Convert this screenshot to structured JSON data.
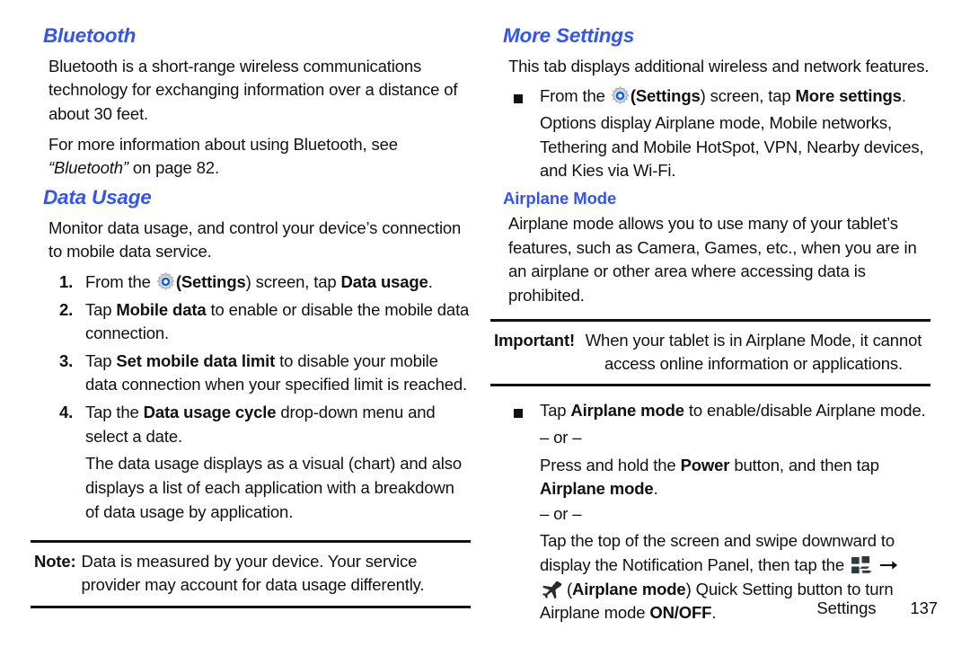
{
  "document": {
    "left_column": {
      "bluetooth": {
        "heading": "Bluetooth",
        "para1": "Bluetooth is a short-range wireless communications technology for exchanging information over a distance of about 30 feet.",
        "para2_pre": "For more information about using Bluetooth, see ",
        "para2_italic": "“Bluetooth”",
        "para2_post": " on page 82."
      },
      "data_usage": {
        "heading": "Data Usage",
        "intro": "Monitor data usage, and control your device’s connection to mobile data service.",
        "steps": [
          {
            "num": "1.",
            "pre": "From the ",
            "icon": "settings-gear-icon",
            "mid_bold_open": "(Settings",
            "mid": ") screen, tap ",
            "bold": "Data usage",
            "post": "."
          },
          {
            "num": "2.",
            "pre": "Tap ",
            "bold": "Mobile data",
            "post": " to enable or disable the mobile data connection."
          },
          {
            "num": "3.",
            "pre": "Tap ",
            "bold": "Set mobile data limit",
            "post": " to disable your mobile data connection when your specified limit is reached."
          },
          {
            "num": "4.",
            "pre": "Tap the ",
            "bold": "Data usage cycle",
            "post": " drop-down menu and select a date."
          }
        ],
        "step4_cont": "The data usage displays as a visual (chart) and also displays a list of each application with a breakdown of data usage by application."
      },
      "note": {
        "tag": "Note:",
        "text": "Data is measured by your device. Your service provider may account for data usage differently."
      }
    },
    "right_column": {
      "more_settings": {
        "heading": "More Settings",
        "intro": "This tab displays additional wireless and network features.",
        "bullet": {
          "pre": "From the ",
          "icon": "settings-gear-icon",
          "mid_bold_open": "(Settings",
          "mid": ") screen, tap ",
          "bold": "More settings",
          "post": "."
        },
        "bullet_cont": "Options display Airplane mode, Mobile networks, Tethering and Mobile HotSpot, VPN, Nearby devices, and Kies via Wi-Fi."
      },
      "airplane_mode": {
        "heading": "Airplane Mode",
        "intro": "Airplane mode allows you to use many of your tablet’s features, such as Camera, Games, etc., when you are in an airplane or other area where accessing data is prohibited.",
        "important": {
          "tag": "Important!",
          "text": "When your tablet is in Airplane Mode, it cannot access online information or applications."
        },
        "bullet": {
          "pre": "Tap ",
          "bold": "Airplane mode",
          "post": " to enable/disable Airplane mode."
        },
        "or_label": "– or –",
        "alt1_pre": "Press and hold the ",
        "alt1_bold": "Power",
        "alt1_mid": " button, and then tap ",
        "alt1_bold2": "Airplane mode",
        "alt1_post": ".",
        "alt2_pre": "Tap the top of the screen and swipe downward to display the Notification Panel, then tap the ",
        "alt2_grid_icon": "quick-settings-grid-icon",
        "alt2_arrow_icon": "right-arrow-icon",
        "alt2_plane_icon": "airplane-icon",
        "alt2_paren_open": "(",
        "alt2_bold": "Airplane mode",
        "alt2_mid": ") Quick Setting button to turn Airplane mode ",
        "alt2_bold2": "ON/OFF",
        "alt2_post": "."
      }
    },
    "footer": {
      "section": "Settings",
      "page": "137"
    },
    "colors": {
      "heading_blue": "#3355ee",
      "body_black": "#111111",
      "rule_black": "#111111",
      "gear_blue": "#1a5fe0"
    }
  }
}
